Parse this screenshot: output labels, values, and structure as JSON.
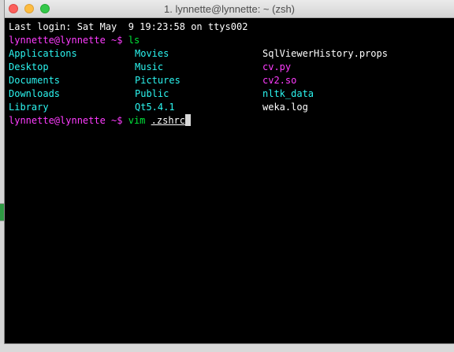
{
  "window": {
    "title": "1. lynnette@lynnette: ~ (zsh)"
  },
  "terminal": {
    "last_login": "Last login: Sat May  9 19:23:58 on ttys002",
    "prompt": "lynnette@lynnette ~$",
    "command1": "ls",
    "listing": [
      [
        {
          "name": "Applications",
          "kind": "dir"
        },
        {
          "name": "Movies",
          "kind": "dir"
        },
        {
          "name": "SqlViewerHistory.props",
          "kind": "file"
        }
      ],
      [
        {
          "name": "Desktop",
          "kind": "dir"
        },
        {
          "name": "Music",
          "kind": "dir"
        },
        {
          "name": "cv.py",
          "kind": "exec"
        }
      ],
      [
        {
          "name": "Documents",
          "kind": "dir"
        },
        {
          "name": "Pictures",
          "kind": "dir"
        },
        {
          "name": "cv2.so",
          "kind": "exec"
        }
      ],
      [
        {
          "name": "Downloads",
          "kind": "dir"
        },
        {
          "name": "Public",
          "kind": "dir"
        },
        {
          "name": "nltk_data",
          "kind": "dir"
        }
      ],
      [
        {
          "name": "Library",
          "kind": "dir"
        },
        {
          "name": "Qt5.4.1",
          "kind": "dir"
        },
        {
          "name": "weka.log",
          "kind": "file"
        }
      ]
    ],
    "command2": "vim",
    "command2_arg": ".zshrc"
  },
  "colors": {
    "prompt": "#ff3cff",
    "directory": "#2cf5f0",
    "command": "#00e639",
    "text": "#ffffff",
    "background": "#000000"
  }
}
